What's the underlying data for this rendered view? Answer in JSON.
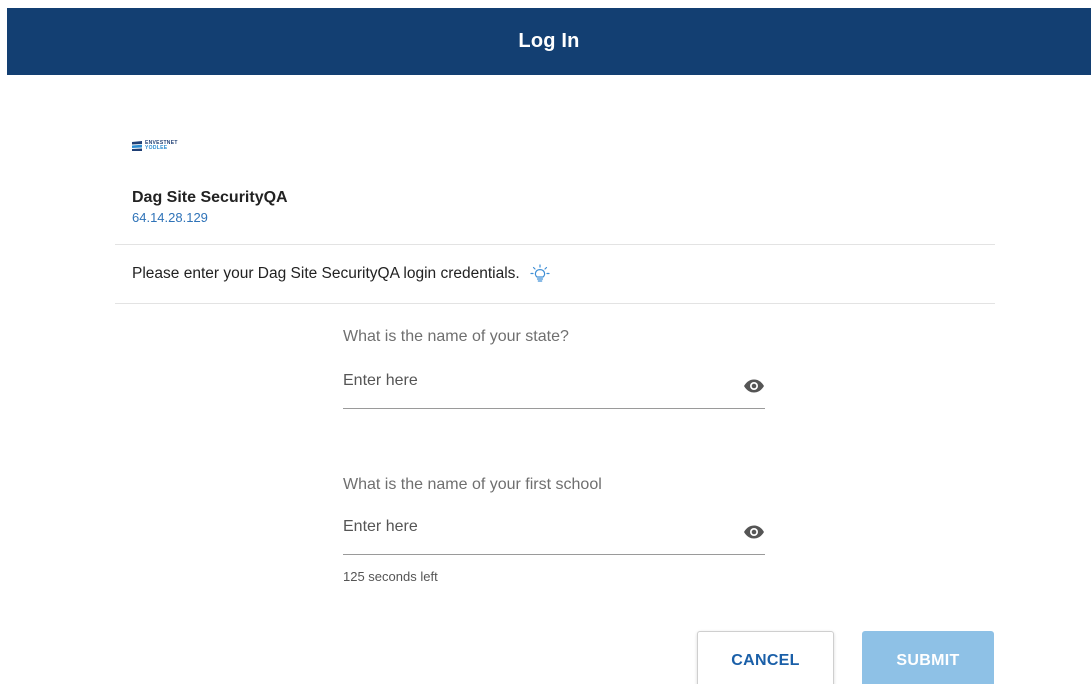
{
  "header": {
    "title": "Log In",
    "background_color": "#133f72"
  },
  "logo": {
    "line1": "ENVESTNET",
    "line2": "YODLEE"
  },
  "site": {
    "name": "Dag Site SecurityQA",
    "address": "64.14.28.129"
  },
  "instruction": {
    "text": "Please enter your Dag Site SecurityQA login credentials.",
    "icon": "lightbulb-icon"
  },
  "questions": [
    {
      "label": "What is the name of your state?",
      "placeholder": "Enter here",
      "value": "",
      "toggle_icon": "eye-icon"
    },
    {
      "label": "What is the name of your first school",
      "placeholder": "Enter here",
      "value": "",
      "toggle_icon": "eye-icon"
    }
  ],
  "timer": {
    "text": "125 seconds left"
  },
  "buttons": {
    "cancel_label": "CANCEL",
    "submit_label": "SUBMIT",
    "accent_color": "#1a5fa8",
    "submit_disabled_color": "#8ec1e6"
  }
}
